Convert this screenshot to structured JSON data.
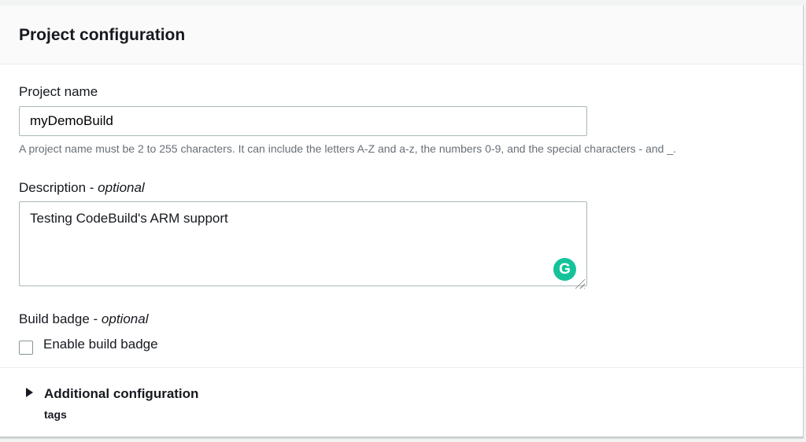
{
  "header": {
    "title": "Project configuration"
  },
  "project_name": {
    "label": "Project name",
    "value": "myDemoBuild",
    "hint": "A project name must be 2 to 255 characters. It can include the letters A-Z and a-z, the numbers 0-9, and the special characters - and _."
  },
  "description": {
    "label": "Description",
    "optional": "optional",
    "value": "Testing CodeBuild's ARM support",
    "grammarly": "G"
  },
  "build_badge": {
    "label": "Build badge",
    "optional": "optional",
    "checkbox_label": "Enable build badge",
    "checked": false
  },
  "additional": {
    "title": "Additional configuration",
    "subtitle": "tags"
  },
  "colors": {
    "grammarly": "#15c39a"
  }
}
